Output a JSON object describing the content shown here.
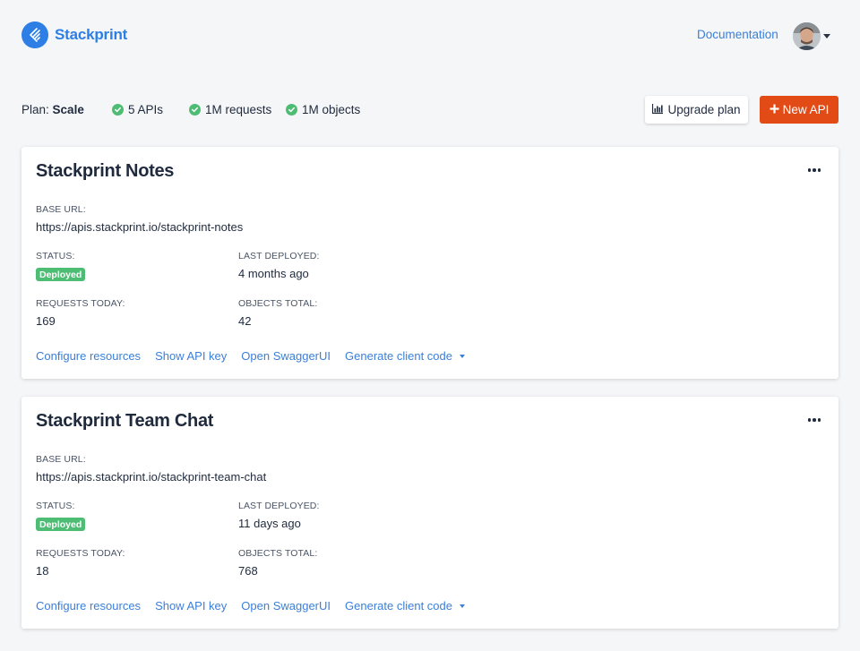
{
  "brand": {
    "name": "Stackprint"
  },
  "header": {
    "documentation_label": "Documentation"
  },
  "plan": {
    "label": "Plan:",
    "name": "Scale",
    "features": [
      "5 APIs",
      "1M requests",
      "1M objects"
    ],
    "upgrade_label": "Upgrade plan",
    "new_api_label": "New API"
  },
  "labels": {
    "base_url": "BASE URL:",
    "status": "STATUS:",
    "last_deployed": "LAST DEPLOYED:",
    "requests_today": "REQUESTS TODAY:",
    "objects_total": "OBJECTS TOTAL:"
  },
  "actions": {
    "configure": "Configure resources",
    "api_key": "Show API key",
    "swagger": "Open SwaggerUI",
    "client_code": "Generate client code"
  },
  "apis": [
    {
      "title": "Stackprint Notes",
      "base_url": "https://apis.stackprint.io/stackprint-notes",
      "status": "Deployed",
      "last_deployed": "4 months ago",
      "requests_today": "169",
      "objects_total": "42"
    },
    {
      "title": "Stackprint Team Chat",
      "base_url": "https://apis.stackprint.io/stackprint-team-chat",
      "status": "Deployed",
      "last_deployed": "11 days ago",
      "requests_today": "18",
      "objects_total": "768"
    }
  ],
  "colors": {
    "accent": "#2d7fe6",
    "link": "#3b7fd8",
    "primary_action": "#e24a16",
    "success": "#4dbd74",
    "background": "#f5f6f8"
  },
  "icons": {
    "logo": "stackprint-logo-icon",
    "check": "check-circle-icon",
    "chart": "bar-chart-icon",
    "plus": "plus-icon",
    "more": "more-horizontal-icon",
    "caret": "caret-down-icon"
  }
}
